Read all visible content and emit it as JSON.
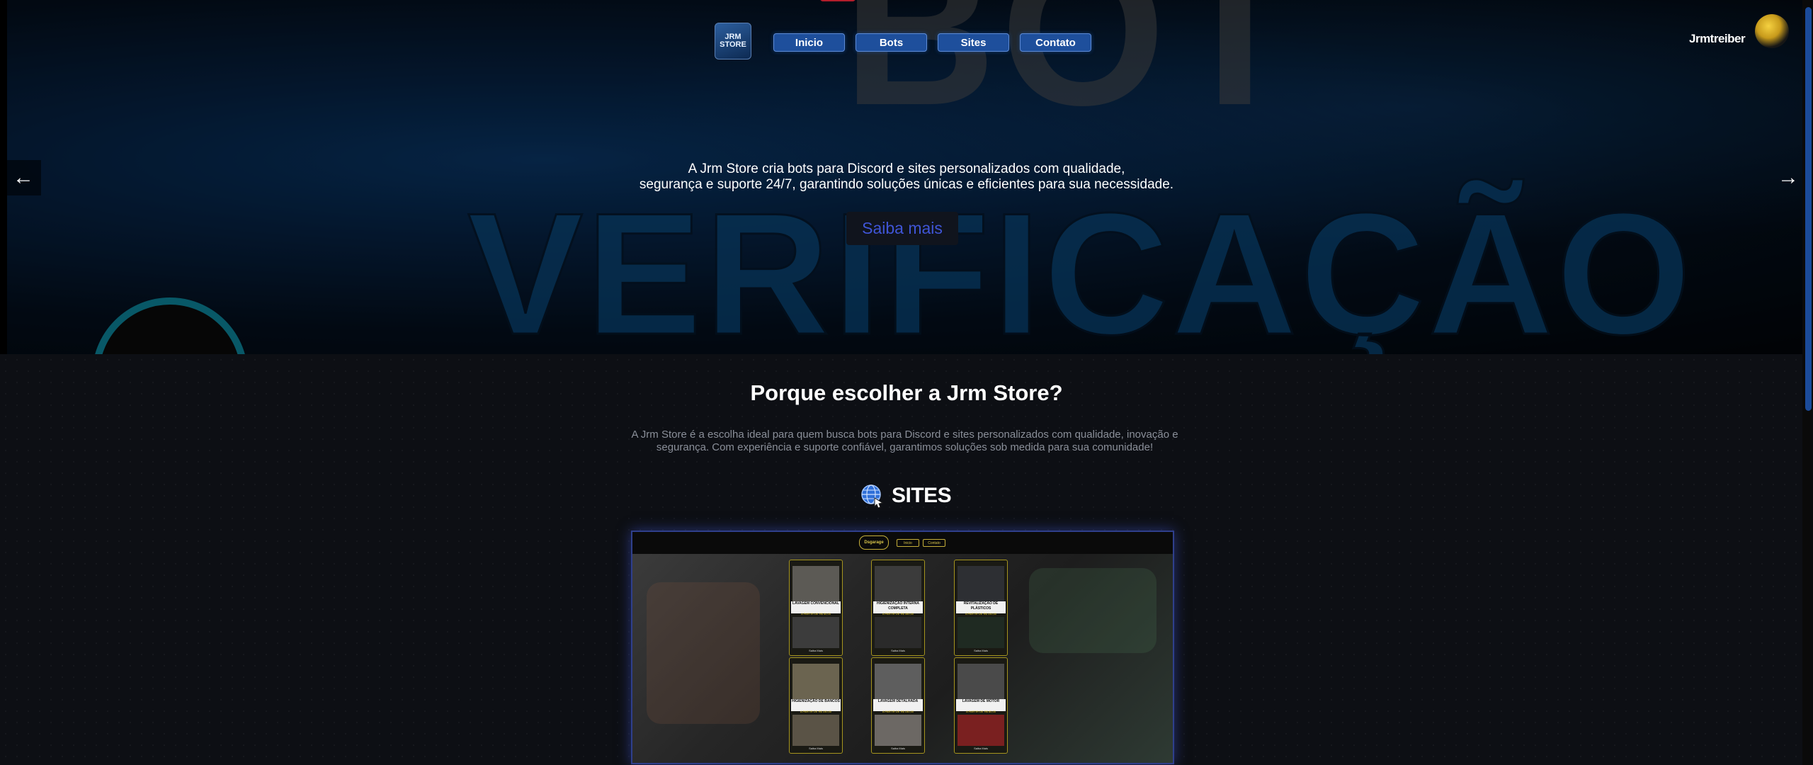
{
  "hero": {
    "bg_word_top": "BOT",
    "bg_word_main": "VERIFICAÇÃO",
    "logo_text_line1": "JRM",
    "logo_text_line2": "STORE",
    "nav": [
      "Inicio",
      "Bots",
      "Sites",
      "Contato"
    ],
    "user_name": "Jrmtreiber",
    "description_line1": "A Jrm Store cria bots para Discord e sites personalizados com qualidade,",
    "description_line2": "segurança e suporte 24/7, garantindo soluções únicas e eficientes para sua necessidade.",
    "cta_label": "Saiba mais",
    "arrow_left": "←",
    "arrow_right": "→"
  },
  "section": {
    "title": "Porque escolher a Jrm Store?",
    "description": "A Jrm Store é a escolha ideal para quem busca bots para Discord e sites personalizados com qualidade, inovação e segurança. Com experiência e suporte confiável, garantimos soluções sob medida para sua comunidade!",
    "sites_label": "SITES",
    "sites_icon": "globe-icon"
  },
  "preview": {
    "logo_text": "Dsgarage",
    "nav": [
      "Inicio",
      "Contato"
    ],
    "cards": [
      {
        "title": "LAVAGEM CONVENCIONAL",
        "sub": "A PARTIR DE R$ 50,00",
        "btn": "Saiba Mais"
      },
      {
        "title": "HIGIENIZAÇÃO INTERNA COMPLETA",
        "sub": "A PARTIR DE R$ 350,00",
        "btn": "Saiba Mais"
      },
      {
        "title": "REVITALIZAÇÃO DE PLÁSTICOS",
        "sub": "A PARTIR DE R$ 100,00",
        "btn": "Saiba Mais"
      },
      {
        "title": "HIGIENIZAÇÃO DE BANCOS",
        "sub": "A PARTIR DE R$ 150,00",
        "btn": "Saiba Mais"
      },
      {
        "title": "LAVAGEM DETALHADA",
        "sub": "A PARTIR DE R$ 150,00",
        "btn": "Saiba Mais"
      },
      {
        "title": "LAVAGEM DE MOTOR",
        "sub": "A PARTIR DE R$ 80,00",
        "btn": "Saiba Mais"
      }
    ]
  },
  "colors": {
    "accent": "#1e4f9c",
    "cta_text": "#3f55d6",
    "preview_gold": "#c7b03a"
  }
}
